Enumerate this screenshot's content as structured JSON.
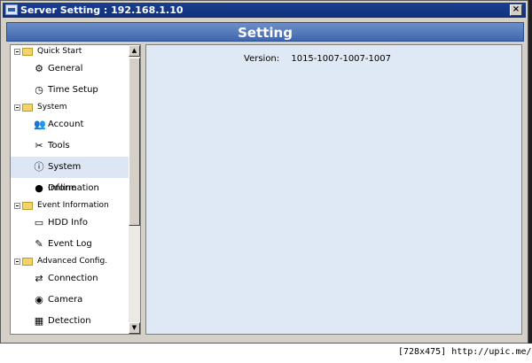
{
  "window": {
    "title": "Server Setting : 192.168.1.10",
    "close_label": "×"
  },
  "banner": {
    "title": "Setting"
  },
  "tree": {
    "categories": [
      {
        "label": "Quick Start",
        "items": [
          {
            "label": "General",
            "icon": "gear-icon",
            "glyph": "⚙"
          },
          {
            "label": "Time Setup",
            "icon": "clock-icon",
            "glyph": "◷"
          }
        ]
      },
      {
        "label": "System",
        "items": [
          {
            "label": "Account",
            "icon": "users-icon",
            "glyph": "👥"
          },
          {
            "label": "Tools",
            "icon": "tools-icon",
            "glyph": "✂"
          },
          {
            "label": "System Information",
            "icon": "info-icon",
            "glyph": "ⓘ",
            "selected": true
          },
          {
            "label": "Online",
            "icon": "user-icon",
            "glyph": "●"
          }
        ]
      },
      {
        "label": "Event Information",
        "items": [
          {
            "label": "HDD Info",
            "icon": "hdd-icon",
            "glyph": "▭"
          },
          {
            "label": "Event Log",
            "icon": "log-icon",
            "glyph": "✎"
          }
        ]
      },
      {
        "label": "Advanced Config.",
        "items": [
          {
            "label": "Connection",
            "icon": "network-icon",
            "glyph": "⇄"
          },
          {
            "label": "Camera",
            "icon": "camera-icon",
            "glyph": "◉"
          },
          {
            "label": "Detection",
            "icon": "grid-icon",
            "glyph": "▦"
          }
        ]
      }
    ]
  },
  "content": {
    "version_label": "Version:",
    "version_value": "1015-1007-1007-1007"
  },
  "footer": {
    "text": "[728x475] http://upic.me/"
  }
}
